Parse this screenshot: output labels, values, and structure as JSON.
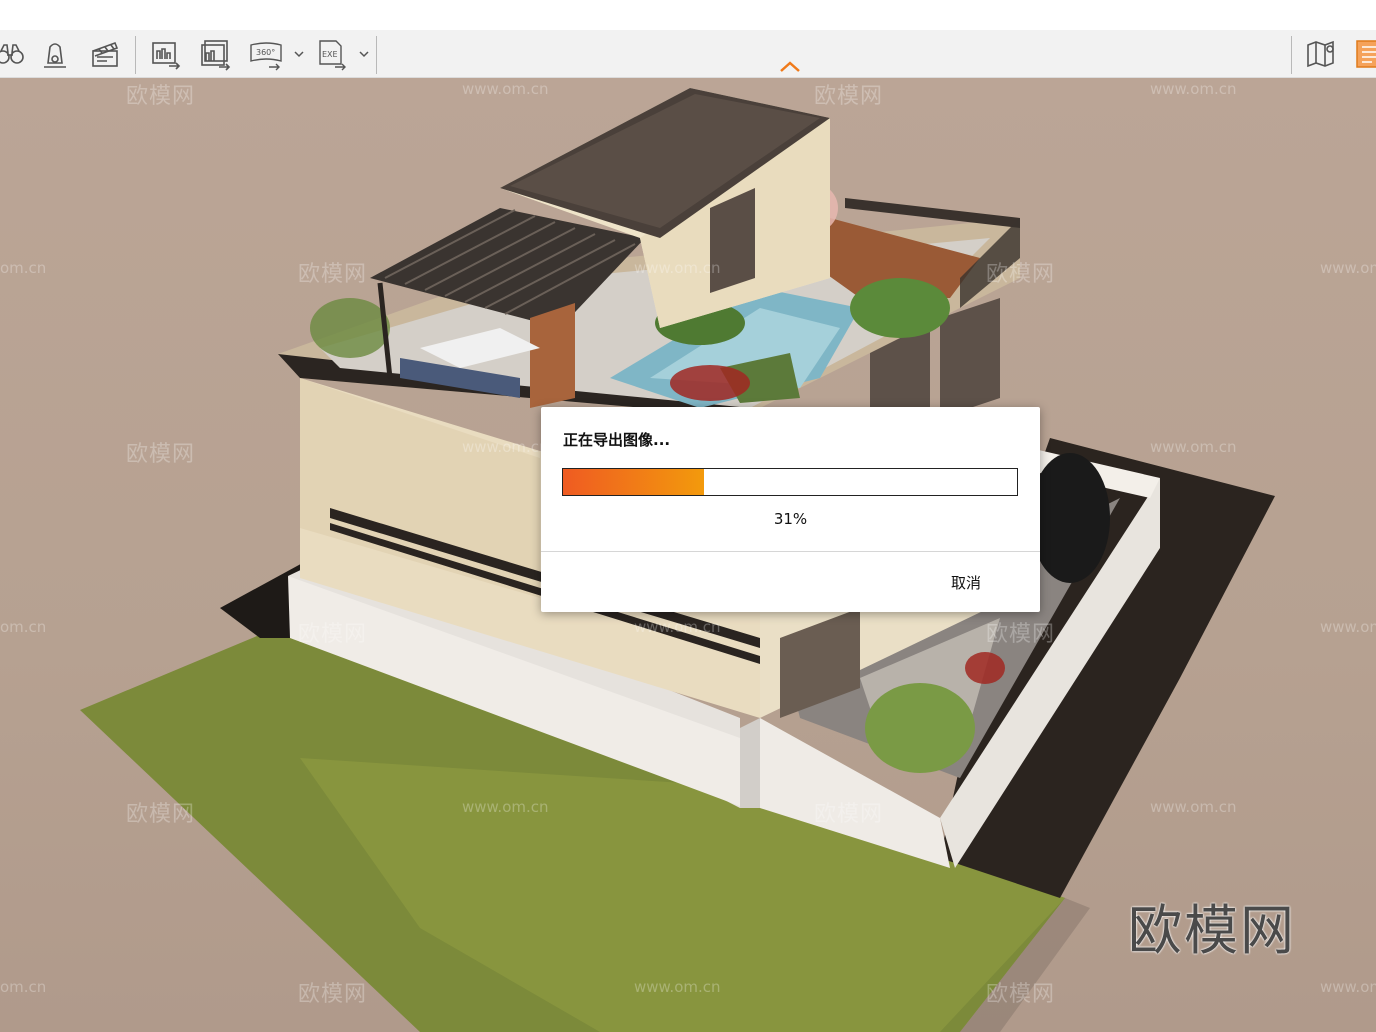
{
  "toolbar": {
    "left_tools": [
      {
        "icon": "binoculars-icon"
      },
      {
        "icon": "bell-icon"
      },
      {
        "icon": "clapperboard-icon"
      },
      {
        "icon": "export-image-icon"
      },
      {
        "icon": "export-batch-icon"
      },
      {
        "icon": "export-360-icon",
        "label": "360°"
      },
      {
        "icon": "export-exe-icon",
        "label": "EXE"
      }
    ],
    "right_tools": [
      {
        "icon": "map-pin-icon"
      },
      {
        "icon": "panel-icon"
      }
    ],
    "accent": "#f07a1a"
  },
  "dialog": {
    "title": "正在导出图像...",
    "progress": 0.31,
    "percent_text": "31%",
    "cancel_label": "取消",
    "fill_start": "#ef5b22",
    "fill_end": "#f39a0c"
  },
  "watermark": {
    "brand": "欧模网",
    "url": "www.om.cn",
    "url_partial": "om.cn"
  }
}
